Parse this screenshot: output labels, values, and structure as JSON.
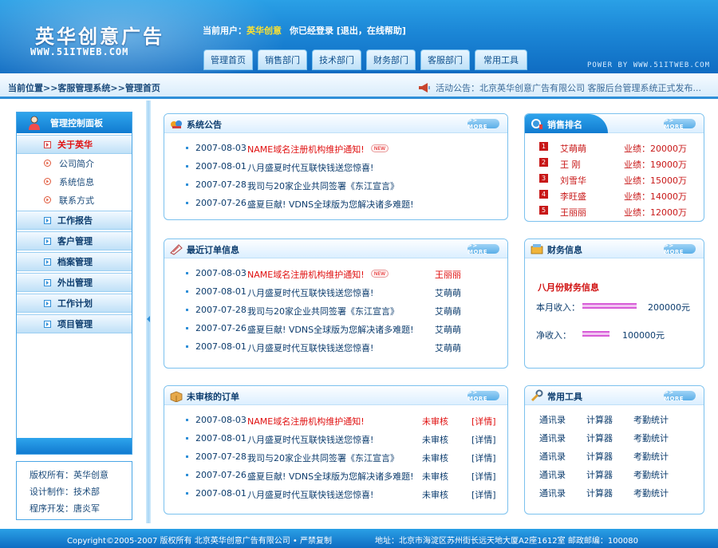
{
  "header": {
    "logo_title": "英华创意广告",
    "logo_url": "WWW.51ITWEB.COM",
    "user_label": "当前用户：",
    "user_name": "英华创意",
    "login_text": "你已经登录 [退出，在线帮助]",
    "power_text": "POWER BY WWW.51ITWEB.COM",
    "tabs": [
      {
        "label": "管理首页"
      },
      {
        "label": "销售部门"
      },
      {
        "label": "技术部门"
      },
      {
        "label": "财务部门"
      },
      {
        "label": "客服部门"
      },
      {
        "label": "常用工具"
      }
    ]
  },
  "location": {
    "breadcrumb": "当前位置>>客服管理系统>>管理首页",
    "notice": "活动公告：北京英华创意广告有限公司 客服后台管理系统正式发布..."
  },
  "sidebar": {
    "title": "管理控制面板",
    "groups": [
      {
        "label": "关于英华",
        "subs": [
          {
            "label": "公司简介"
          },
          {
            "label": "系统信息"
          },
          {
            "label": "联系方式"
          }
        ]
      },
      {
        "label": "工作报告"
      },
      {
        "label": "客户管理"
      },
      {
        "label": "档案管理"
      },
      {
        "label": "外出管理"
      },
      {
        "label": "工作计划"
      },
      {
        "label": "项目管理"
      }
    ]
  },
  "copyright_box": {
    "owner": "版权所有：英华创意",
    "design": "设计制作：技术部",
    "dev": "程序开发：唐炎军"
  },
  "more_label": ">> MORE",
  "new_label": "NEW",
  "announcements": {
    "title": "系统公告",
    "items": [
      {
        "date": "2007-08-03",
        "title": "NAME域名注册机构维护通知!"
      },
      {
        "date": "2007-08-01",
        "title": "八月盛夏时代互联快钱送您惊喜!"
      },
      {
        "date": "2007-07-28",
        "title": "我司与20家企业共同签署《东江宣言》"
      },
      {
        "date": "2007-07-26",
        "title": "盛夏巨献! VDNS全球版为您解决诸多难题!"
      }
    ]
  },
  "recent_orders": {
    "title": "最近订单信息",
    "items": [
      {
        "date": "2007-08-03",
        "title": "NAME域名注册机构维护通知!",
        "person": "王丽丽"
      },
      {
        "date": "2007-08-01",
        "title": "八月盛夏时代互联快钱送您惊喜!",
        "person": "艾萌萌"
      },
      {
        "date": "2007-07-28",
        "title": "我司与20家企业共同签署《东江宣言》",
        "person": "艾萌萌"
      },
      {
        "date": "2007-07-26",
        "title": "盛夏巨献! VDNS全球版为您解决诸多难题!",
        "person": "艾萌萌"
      },
      {
        "date": "2007-08-01",
        "title": "八月盛夏时代互联快钱送您惊喜!",
        "person": "艾萌萌"
      }
    ]
  },
  "pending_orders": {
    "title": "未审核的订单",
    "items": [
      {
        "date": "2007-08-03",
        "title": "NAME域名注册机构维护通知!",
        "status": "未审核",
        "detail": "[详情]"
      },
      {
        "date": "2007-08-01",
        "title": "八月盛夏时代互联快钱送您惊喜!",
        "status": "未审核",
        "detail": "[详情]"
      },
      {
        "date": "2007-07-28",
        "title": "我司与20家企业共同签署《东江宣言》",
        "status": "未审核",
        "detail": "[详情]"
      },
      {
        "date": "2007-07-26",
        "title": "盛夏巨献! VDNS全球版为您解决诸多难题!",
        "status": "未审核",
        "detail": "[详情]"
      },
      {
        "date": "2007-08-01",
        "title": "八月盛夏时代互联快钱送您惊喜!",
        "status": "未审核",
        "detail": "[详情]"
      }
    ]
  },
  "sales_ranking": {
    "title": "销售排名",
    "items": [
      {
        "rank": "1",
        "name": "艾萌萌",
        "perf": "业绩：20000万"
      },
      {
        "rank": "2",
        "name": "王  刚",
        "perf": "业绩：19000万"
      },
      {
        "rank": "3",
        "name": "刘雪华",
        "perf": "业绩：15000万"
      },
      {
        "rank": "4",
        "name": "李旺盛",
        "perf": "业绩：14000万"
      },
      {
        "rank": "5",
        "name": "王丽丽",
        "perf": "业绩：12000万"
      }
    ]
  },
  "finance": {
    "title": "财务信息",
    "subtitle": "八月份财务信息",
    "income_label": "本月收入：",
    "income_value": "200000元",
    "net_label": "净收入：",
    "net_value": "100000元",
    "income_amount": 200000,
    "net_amount": 100000
  },
  "tools": {
    "title": "常用工具",
    "rows": [
      [
        "通讯录",
        "计算器",
        "考勤统计"
      ],
      [
        "通讯录",
        "计算器",
        "考勤统计"
      ],
      [
        "通讯录",
        "计算器",
        "考勤统计"
      ],
      [
        "通讯录",
        "计算器",
        "考勤统计"
      ],
      [
        "通讯录",
        "计算器",
        "考勤统计"
      ]
    ]
  },
  "footer": {
    "left": "Copyright©2005-2007  版权所有  北京英华创意广告有限公司 • 严禁复制",
    "right": "地址：北京市海淀区苏州街长远天地大厦A2座1612室    邮政邮编：100080"
  },
  "colors": {
    "brand_blue": "#1b86d6",
    "accent_red": "#e01010",
    "highlight_yellow": "#ffe22e",
    "bar_magenta": "#d75bd7"
  }
}
